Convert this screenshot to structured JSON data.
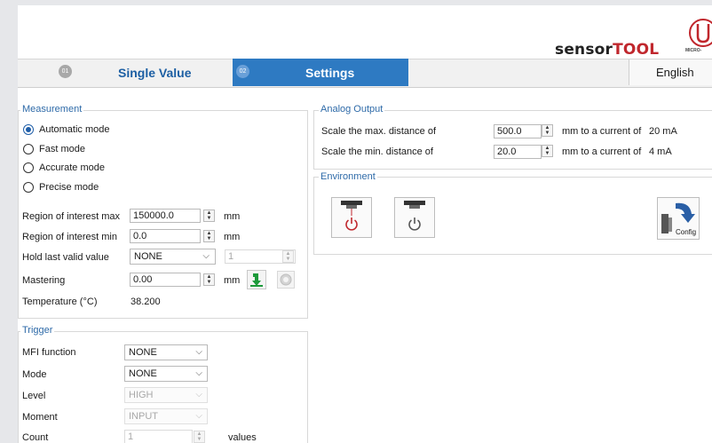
{
  "header": {
    "brand_sensor": "sensor",
    "brand_tool": "TOOL",
    "logo_text": "MICRO-"
  },
  "tabs": [
    {
      "num": "01",
      "label": "Single Value"
    },
    {
      "num": "02",
      "label": "Settings"
    }
  ],
  "language": "English",
  "measurement": {
    "title": "Measurement",
    "modes": [
      "Automatic mode",
      "Fast  mode",
      "Accurate  mode",
      "Precise  mode"
    ],
    "selected_mode": "Automatic mode",
    "roi_max": {
      "label": "Region of interest max",
      "value": "150000.0",
      "unit": "mm"
    },
    "roi_min": {
      "label": "Region of interest min",
      "value": "0.0",
      "unit": "mm"
    },
    "hold": {
      "label": "Hold last valid value",
      "value": "NONE",
      "count": "1"
    },
    "mastering": {
      "label": "Mastering",
      "value": "0.00",
      "unit": "mm"
    },
    "temperature": {
      "label": "Temperature (°C)",
      "value": "38.200"
    }
  },
  "analog": {
    "title": "Analog Output",
    "max": {
      "label": "Scale the max. distance of",
      "value": "500.0",
      "unit": "mm to a current of",
      "current": "20 mA"
    },
    "min": {
      "label": "Scale the min. distance of",
      "value": "20.0",
      "unit": "mm to a current of",
      "current": "4 mA"
    }
  },
  "environment": {
    "title": "Environment",
    "config_label": "Config"
  },
  "trigger": {
    "title": "Trigger",
    "mfi": {
      "label": "MFI function",
      "value": "NONE"
    },
    "mode": {
      "label": "Mode",
      "value": "NONE"
    },
    "level": {
      "label": "Level",
      "value": "HIGH"
    },
    "moment": {
      "label": "Moment",
      "value": "INPUT"
    },
    "count": {
      "label": "Count",
      "value": "1",
      "unit": "values"
    }
  },
  "colors": {
    "accent": "#2e7ac2",
    "title_blue": "#2e6aa8",
    "brand_red": "#c0272d"
  }
}
